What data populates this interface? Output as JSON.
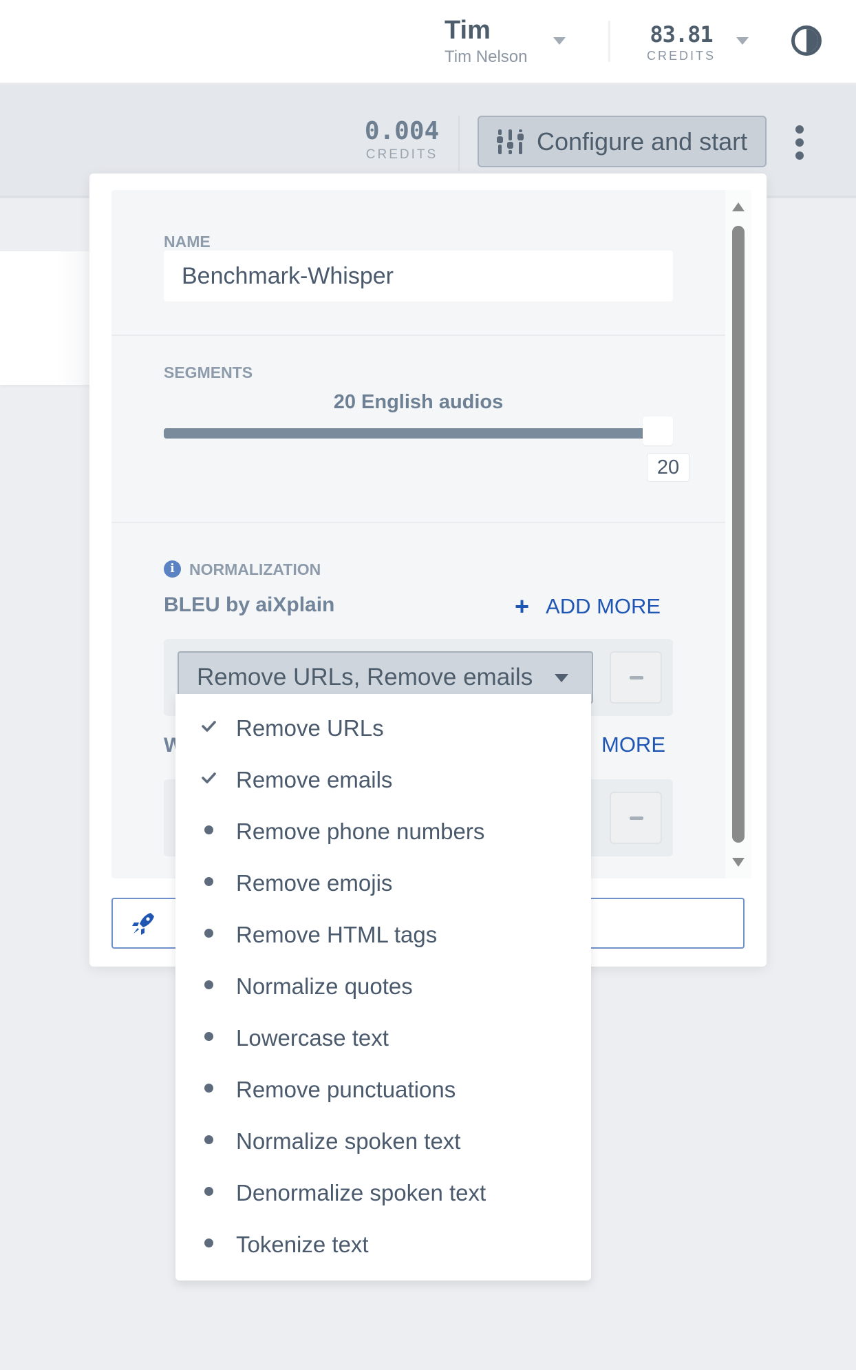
{
  "header": {
    "user_first_name": "Tim",
    "user_full_name": "Tim Nelson",
    "credits_value": "83.81",
    "credits_label": "CREDITS",
    "theme_toggle_icon": "contrast-icon"
  },
  "toolbar": {
    "cost_value": "0.004",
    "cost_label": "CREDITS",
    "configure_button_label": "Configure and start",
    "configure_button_icon": "sliders-icon",
    "more_icon": "vertical-ellipsis-icon"
  },
  "panel": {
    "name_section": {
      "label": "NAME",
      "value": "Benchmark-Whisper",
      "placeholder": ""
    },
    "segments_section": {
      "label": "SEGMENTS",
      "caption": "20 English audios",
      "slider_value": 20,
      "slider_max": 20,
      "slider_fraction": 1.0,
      "value_display": "20"
    },
    "normalization_section": {
      "label": "NORMALIZATION",
      "info_icon": "info-icon",
      "metrics": [
        {
          "name": "BLEU by aiXplain",
          "add_more_label": "ADD MORE",
          "selected_value": "Remove URLs, Remove emails"
        },
        {
          "name": "W",
          "add_more_label": "MORE",
          "selected_value": ""
        }
      ]
    },
    "start_button_icon": "rocket-icon"
  },
  "dropdown": {
    "options": [
      {
        "label": "Remove URLs",
        "selected": true
      },
      {
        "label": "Remove emails",
        "selected": true
      },
      {
        "label": "Remove phone numbers",
        "selected": false
      },
      {
        "label": "Remove emojis",
        "selected": false
      },
      {
        "label": "Remove HTML tags",
        "selected": false
      },
      {
        "label": "Normalize quotes",
        "selected": false
      },
      {
        "label": "Lowercase text",
        "selected": false
      },
      {
        "label": "Remove punctuations",
        "selected": false
      },
      {
        "label": "Normalize spoken text",
        "selected": false
      },
      {
        "label": "Denormalize spoken text",
        "selected": false
      },
      {
        "label": "Tokenize text",
        "selected": false
      }
    ]
  },
  "colors": {
    "accent_blue": "#1f56b3",
    "text_primary": "#4a5a6c",
    "label_gray": "#8d9bab",
    "slider_fill": "#7a8b9b"
  }
}
